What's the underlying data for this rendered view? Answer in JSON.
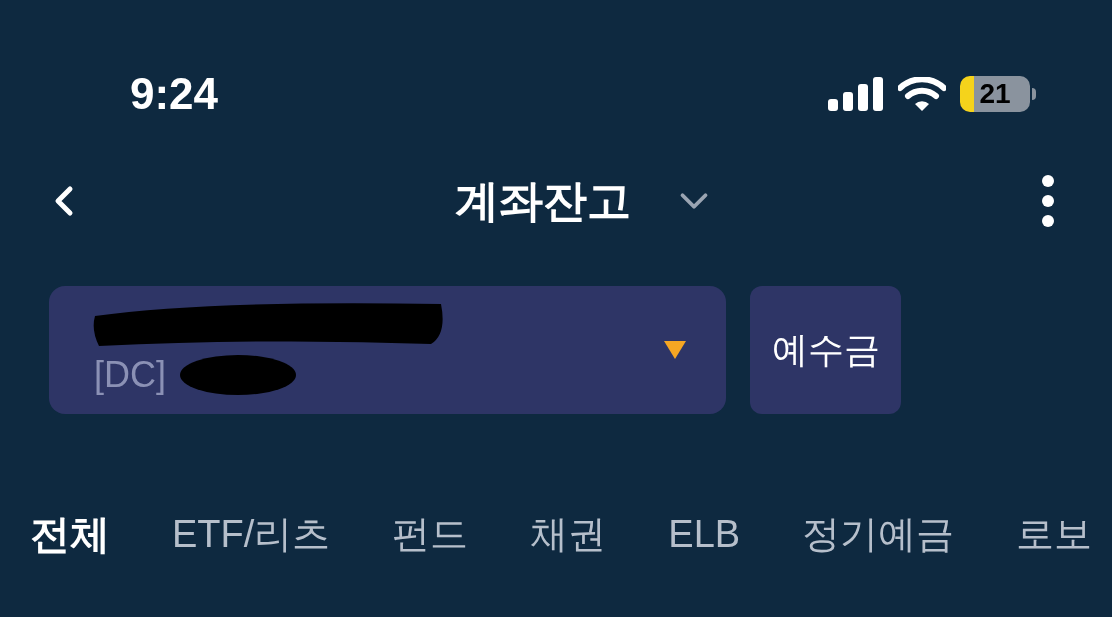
{
  "status_bar": {
    "time": "9:24",
    "battery": "21"
  },
  "header": {
    "title": "계좌잔고"
  },
  "account": {
    "type_label": "[DC]",
    "redacted": true
  },
  "deposit_button": "예수금",
  "tabs": [
    {
      "label": "전체",
      "selected": true
    },
    {
      "label": "ETF/리츠",
      "selected": false
    },
    {
      "label": "펀드",
      "selected": false
    },
    {
      "label": "채권",
      "selected": false
    },
    {
      "label": "ELB",
      "selected": false
    },
    {
      "label": "정기예금",
      "selected": false
    },
    {
      "label": "로보",
      "selected": false
    }
  ]
}
